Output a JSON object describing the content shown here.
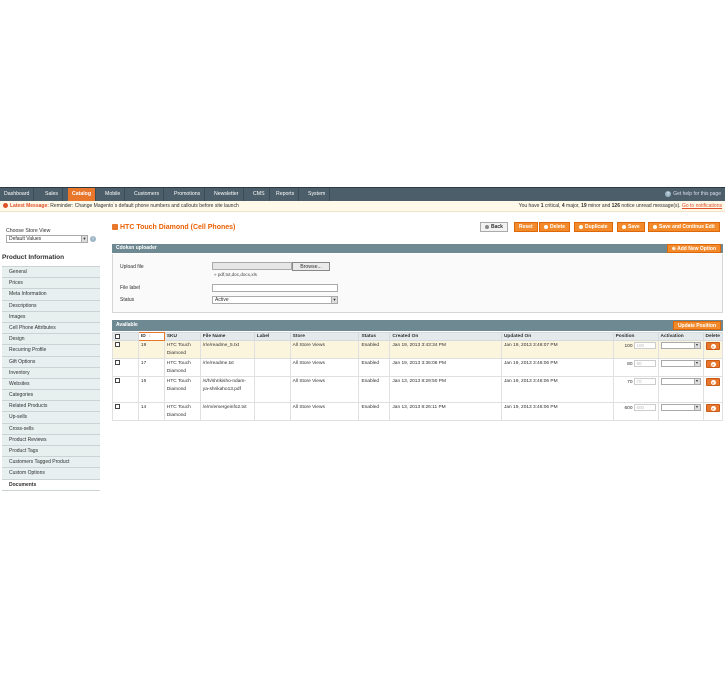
{
  "nav": {
    "items": [
      "Dashboard",
      "Sales",
      "Catalog",
      "Mobile",
      "Customers",
      "Promotions",
      "Newsletter",
      "CMS",
      "Reports",
      "System"
    ],
    "help": "Get help for this page"
  },
  "message": {
    "label": "Latest Message:",
    "text": "Reminder: Change Magento`s default phone numbers and callouts before site launch",
    "summary_prefix": "You have",
    "critical_count": "1",
    "critical_label": "critical",
    "major_count": "4",
    "major_label": "major",
    "minor_count": "19",
    "minor_label": "minor and",
    "notice_count": "126",
    "notice_label": "notice unread message(s).",
    "link": "Go to notifications"
  },
  "sidebar": {
    "store_view_label": "Choose Store View",
    "store_view_value": "Default Values",
    "title": "Product Information",
    "tabs": [
      "General",
      "Prices",
      "Meta Information",
      "Descriptions",
      "Images",
      "Cell Phone Attributes",
      "Design",
      "Recurring Profile",
      "Gift Options",
      "Inventory",
      "Websites",
      "Categories",
      "Related Products",
      "Up-sells",
      "Cross-sells",
      "Product Reviews",
      "Product Tags",
      "Customers Tagged Product",
      "Custom Options",
      "Documents"
    ]
  },
  "header": {
    "title": "HTC Touch Diamond (Cell Phones)",
    "buttons": {
      "back": "Back",
      "reset": "Reset",
      "delete": "Delete",
      "duplicate": "Duplicate",
      "save": "Save",
      "save_continue": "Save and Continue Edit"
    }
  },
  "uploader": {
    "title": "Cdoksn uploader",
    "add_button": "Add New Option",
    "file_label": "Upload file",
    "browse": "Browse...",
    "hint": "pdf,txt,doc,docx,xls",
    "file_label_label": "File label",
    "status_label": "Status",
    "status_value": "Active"
  },
  "grid": {
    "title": "Available",
    "update_button": "Update Position",
    "columns": [
      "ID",
      "SKU",
      "File Name",
      "Label",
      "Store",
      "Status",
      "Created On",
      "Updated On",
      "Position",
      "Activation",
      "Delete"
    ],
    "rows": [
      {
        "id": "19",
        "sku": "HTC Touch Diamond",
        "file": "/r/e/readme_5.txt",
        "label": "",
        "store": "All Store Views",
        "status": "Enabled",
        "created": "Jan 19, 2013 3:43:34 PM",
        "updated": "Jan 19, 2013 3:46:07 PM",
        "position": "100",
        "position_placeholder": "100"
      },
      {
        "id": "17",
        "sku": "HTC Touch Diamond",
        "file": "/r/e/readme.txt",
        "label": "",
        "store": "All Store Views",
        "status": "Enabled",
        "created": "Jan 19, 2013 3:36:06 PM",
        "updated": "Jan 19, 2013 3:46:06 PM",
        "position": "80",
        "position_placeholder": "80"
      },
      {
        "id": "15",
        "sku": "HTC Touch Diamond",
        "file": "/s/h/shrikisho-ndam-ya-shrikaho13.pdf",
        "label": "",
        "store": "All Store Views",
        "status": "Enabled",
        "created": "Jan 13, 2013 8:29:50 PM",
        "updated": "Jan 19, 2013 3:46:06 PM",
        "position": "70",
        "position_placeholder": "70"
      },
      {
        "id": "14",
        "sku": "HTC Touch Diamond",
        "file": "/e/m/emergeinfo2.txt",
        "label": "",
        "store": "All Store Views",
        "status": "Enabled",
        "created": "Jan 13, 2013 8:26:11 PM",
        "updated": "Jan 19, 2013 3:46:06 PM",
        "position": "600",
        "position_placeholder": "600"
      }
    ]
  },
  "colors": {
    "nav_bg": "#4b5e69",
    "accent": "#e8762b",
    "section_head": "#6f8992",
    "highlight_row": "#fcf5dd"
  }
}
